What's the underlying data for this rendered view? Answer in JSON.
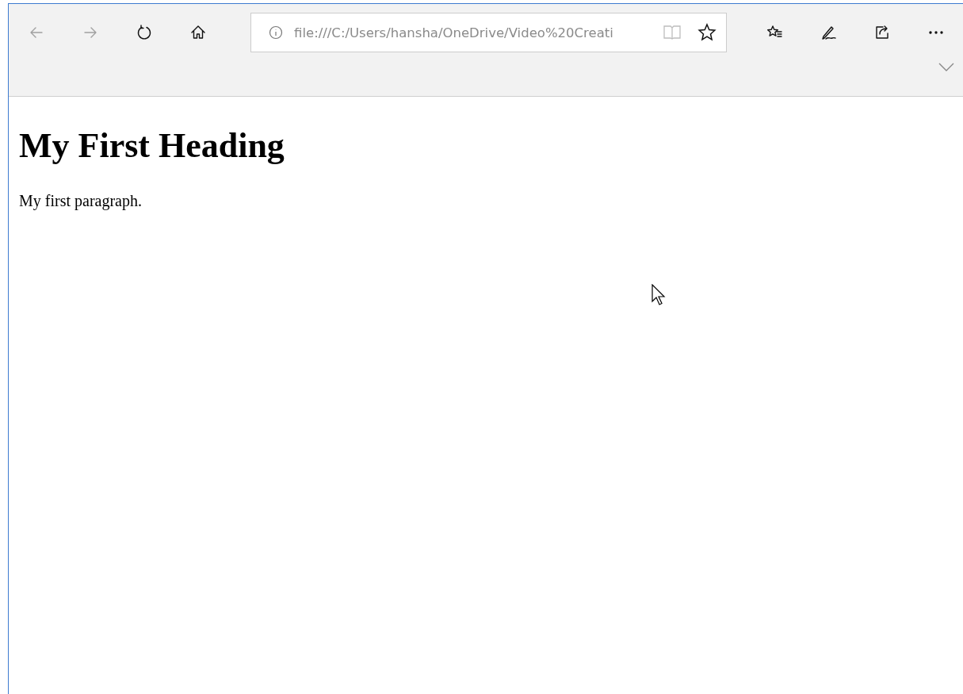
{
  "toolbar": {
    "nav_buttons": [
      {
        "kind": "back",
        "disabled": true
      },
      {
        "kind": "forward",
        "disabled": true
      },
      {
        "kind": "refresh",
        "disabled": false
      },
      {
        "kind": "home",
        "disabled": false
      }
    ],
    "address_bar": {
      "value": "file:///C:/Users/hansha/OneDrive/Video%20Creati",
      "reading_view_disabled": true
    },
    "actions": [
      {
        "kind": "favorites"
      },
      {
        "kind": "notes"
      },
      {
        "kind": "share"
      },
      {
        "kind": "more"
      }
    ]
  },
  "page": {
    "heading": "My First Heading",
    "paragraph": "My first paragraph."
  }
}
